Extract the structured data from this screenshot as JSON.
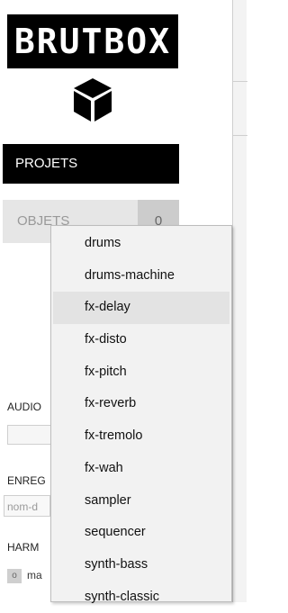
{
  "logo": {
    "text": "BRUTBOX",
    "icon": "cube-icon"
  },
  "nav": {
    "projets_label": "PROJETS",
    "objets_label": "OBJETS",
    "objets_count": "0"
  },
  "sections": {
    "audio_label": "AUDIO",
    "enreg_label": "ENREG",
    "enreg_placeholder": "nom-d",
    "harm_label": "HARM",
    "harm_check_mark": "o",
    "harm_text": "ma"
  },
  "dropdown": {
    "highlighted": "fx-delay",
    "items": [
      "drums",
      "drums-machine",
      "fx-delay",
      "fx-disto",
      "fx-pitch",
      "fx-reverb",
      "fx-tremolo",
      "fx-wah",
      "sampler",
      "sequencer",
      "synth-bass",
      "synth-classic"
    ]
  },
  "colors": {
    "black": "#000000",
    "menu_bg": "#f2f2f2",
    "highlight_bg": "#e3e3e3",
    "objets_bg": "#e6e6e6"
  }
}
